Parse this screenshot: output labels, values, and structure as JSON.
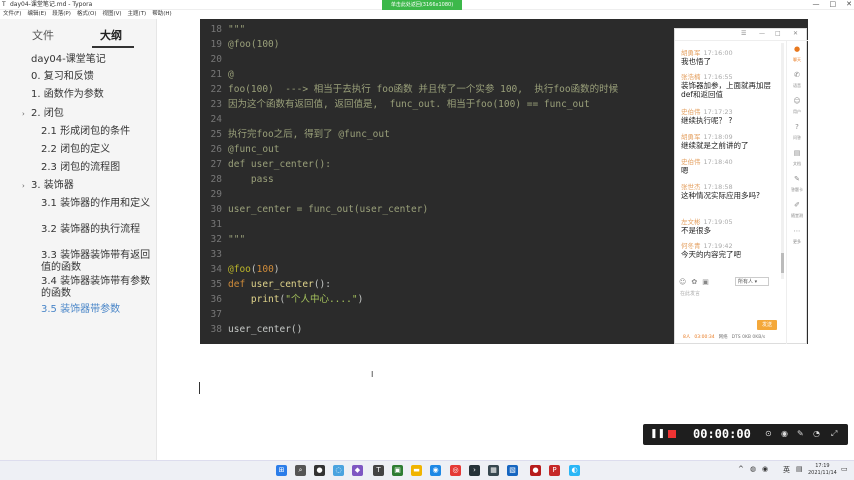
{
  "titlebar": {
    "title": "day04-课堂笔记.md - Typora",
    "recording_label": "单击此处返回(3166x1080)",
    "minimize": "—",
    "maximize": "□",
    "close": "✕"
  },
  "menu": [
    "文件(F)",
    "编辑(E)",
    "段落(P)",
    "格式(O)",
    "视图(V)",
    "主题(T)",
    "帮助(H)"
  ],
  "sidebar": {
    "tab_files": "文件",
    "tab_outline": "大纲",
    "items": [
      {
        "text": "day04-课堂笔记"
      },
      {
        "text": "0. 复习和反馈"
      },
      {
        "text": "1. 函数作为参数"
      },
      {
        "text": "2. 闭包"
      },
      {
        "text": "2.1 形成闭包的条件"
      },
      {
        "text": "2.2 闭包的定义"
      },
      {
        "text": "2.3 闭包的流程图"
      },
      {
        "text": "3. 装饰器"
      },
      {
        "text": "3.1 装饰器的作用和定义"
      },
      {
        "text": "3.2 装饰器的执行流程"
      },
      {
        "text": "3.3 装饰器装饰带有返回值的函数"
      },
      {
        "text": "3.4 装饰器装饰带有参数的函数"
      },
      {
        "text": "3.5 装饰器带参数"
      }
    ],
    "bottom_back": "‹",
    "bottom_source": "</>"
  },
  "code": {
    "lines": [
      {
        "n": "18",
        "t": "\"\"\""
      },
      {
        "n": "19",
        "t": "@foo(100)"
      },
      {
        "n": "20",
        "t": ""
      },
      {
        "n": "21",
        "t": "@"
      },
      {
        "n": "22",
        "t": "foo(100)  ---> 相当于去执行 foo函数 并且传了一个实参 100,  执行foo函数的时候"
      },
      {
        "n": "23",
        "t": "因为这个函数有返回值, 返回值是,  func_out. 相当于foo(100) == func_out"
      },
      {
        "n": "24",
        "t": ""
      },
      {
        "n": "25",
        "t": "执行完foo之后, 得到了 @func_out"
      },
      {
        "n": "26",
        "t": "@func_out"
      },
      {
        "n": "27",
        "t": "def user_center():"
      },
      {
        "n": "28",
        "t": "    pass"
      },
      {
        "n": "29",
        "t": ""
      },
      {
        "n": "30",
        "t": "user_center = func_out(user_center)"
      },
      {
        "n": "31",
        "t": ""
      },
      {
        "n": "32",
        "t": "\"\"\""
      },
      {
        "n": "33",
        "t": ""
      },
      {
        "n": "34",
        "deco": "@foo",
        "paren": "(",
        "num": "100",
        "close": ")"
      },
      {
        "n": "35",
        "kw": "def",
        "fn": " user_center",
        "rest": "():"
      },
      {
        "n": "36",
        "indent": "    ",
        "fn": "print",
        "open": "(",
        "str": "\"个人中心....\"",
        "close": ")"
      },
      {
        "n": "37",
        "t": ""
      },
      {
        "n": "38",
        "plain": "user_center()"
      }
    ]
  },
  "chat": {
    "messages": [
      {
        "name": "胡勇军",
        "time": "17:16:00",
        "text": "我也悟了"
      },
      {
        "name": "张浩楠",
        "time": "17:16:55",
        "text": "装饰器加参，上面就再加层def和返回值"
      },
      {
        "name": "史伯伟",
        "time": "17:17:23",
        "text": "继续执行呢？ ?"
      },
      {
        "name": "胡勇军",
        "time": "17:18:09",
        "text": "继续就是之前讲的了"
      },
      {
        "name": "史伯伟",
        "time": "17:18:40",
        "text": "嗯"
      },
      {
        "name": "张世杰",
        "time": "17:18:58",
        "text": "这种情况实际应用多吗?"
      },
      {
        "name": "左文彬",
        "time": "17:19:05",
        "text": "不是很多"
      },
      {
        "name": "何冬青",
        "time": "17:19:42",
        "text": "今天的内容完了吧"
      }
    ],
    "select_value": "所有人",
    "input_placeholder": "在此发言",
    "send_label": "发送",
    "status": {
      "count": "8人",
      "time": "03:00:34",
      "label": "网络",
      "speed": "DTS 0KB 0KB/s"
    },
    "side": [
      {
        "icon": "●",
        "label": "聊天"
      },
      {
        "icon": "✆",
        "label": "语音"
      },
      {
        "icon": "☺",
        "label": "用户"
      },
      {
        "icon": "?",
        "label": "问答"
      },
      {
        "icon": "▤",
        "label": "文档"
      },
      {
        "icon": "✎",
        "label": "答题卡"
      },
      {
        "icon": "✐",
        "label": "随堂测"
      },
      {
        "icon": "⋯",
        "label": "更多"
      }
    ],
    "controls": [
      "☰",
      "—",
      "□",
      "✕"
    ]
  },
  "recorder": {
    "time": "00:00:00"
  },
  "taskbar": {
    "lang": "英",
    "clock_time": "17:19",
    "clock_date": "2021/11/14"
  }
}
